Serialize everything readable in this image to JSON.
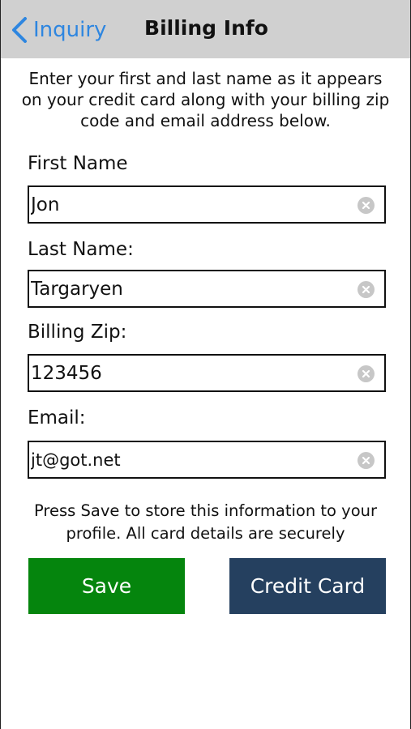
{
  "nav": {
    "back_label": "Inquiry",
    "title": "Billing Info"
  },
  "intro_text": "Enter your first and last name as it appears on your credit card along with your billing zip code and email address below.",
  "fields": [
    {
      "label": "First Name",
      "value": "Jon"
    },
    {
      "label": "Last Name:",
      "value": "Targaryen"
    },
    {
      "label": "Billing Zip:",
      "value": "123456"
    },
    {
      "label": "Email:",
      "value": "jt@got.net"
    }
  ],
  "notice_text": "Press Save to store this information to your profile. All card details are securely",
  "buttons": {
    "save_label": "Save",
    "credit_card_label": "Credit Card"
  },
  "colors": {
    "nav_bg": "#d0d0d0",
    "link": "#2e86e0",
    "save": "#05850d",
    "credit_card": "#25405f"
  }
}
